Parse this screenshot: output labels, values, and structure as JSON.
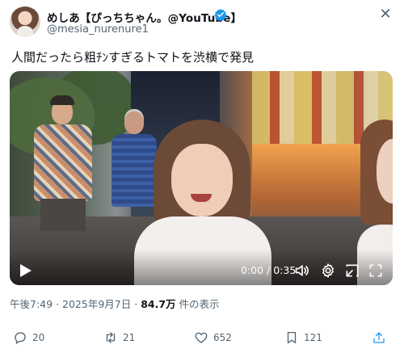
{
  "post": {
    "display_name": "めしあ【ぴっちちゃん。@YouTube】",
    "handle": "@mesia_nurenure1",
    "text": "人間だったら粗ﾁﾝすぎるトマトを渋横で発見",
    "close_icon": "x-icon"
  },
  "video": {
    "time": "0:00 / 0:35",
    "icons": [
      "play-icon",
      "volume-icon",
      "settings-icon",
      "pip-icon",
      "fullscreen-icon"
    ]
  },
  "meta": {
    "time": "午後7:49",
    "date": "2025年9月7日",
    "views_value": "84.7万",
    "views_suffix": "件の表示",
    "separator": "·"
  },
  "actions": {
    "replies": "20",
    "reposts": "21",
    "likes": "652",
    "bookmarks": "121"
  },
  "colors": {
    "text": "#0f1419",
    "secondary": "#536471",
    "verified": "#1d9bf0",
    "share": "#1d9bf0"
  }
}
